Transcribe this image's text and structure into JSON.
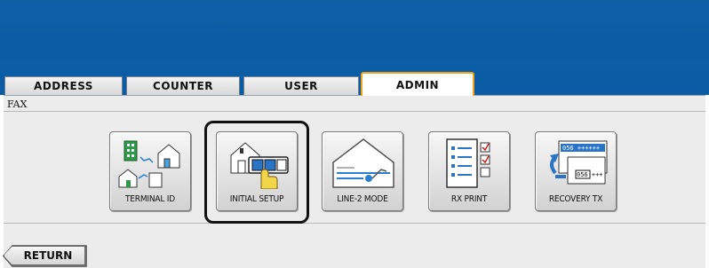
{
  "tabs": [
    {
      "label": "ADDRESS"
    },
    {
      "label": "COUNTER"
    },
    {
      "label": "USER"
    },
    {
      "label": "ADMIN",
      "active": true
    }
  ],
  "breadcrumb": "FAX",
  "functions": [
    {
      "label": "TERMINAL ID",
      "icon": "terminal-id-icon"
    },
    {
      "label": "INITIAL SETUP",
      "icon": "initial-setup-icon",
      "selected": true
    },
    {
      "label": "LINE-2 MODE",
      "icon": "line-2-mode-icon"
    },
    {
      "label": "RX PRINT",
      "icon": "rx-print-icon"
    },
    {
      "label": "RECOVERY TX",
      "icon": "recovery-tx-icon"
    }
  ],
  "return_label": "RETURN",
  "colors": {
    "header_blue": "#0a5ca4",
    "active_tab_border": "#f2a21a",
    "panel_gray": "#ececec"
  }
}
